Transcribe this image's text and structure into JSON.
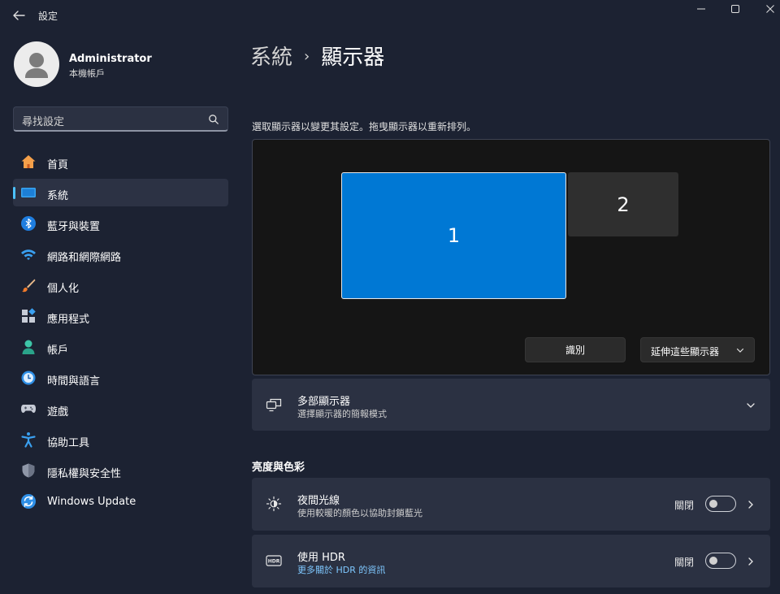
{
  "window": {
    "title": "設定"
  },
  "user": {
    "name": "Administrator",
    "account_type": "本機帳戶"
  },
  "search": {
    "placeholder": "尋找設定"
  },
  "nav": {
    "items": [
      {
        "label": "首頁",
        "icon": "home-icon",
        "active": false
      },
      {
        "label": "系統",
        "icon": "system-display-icon",
        "active": true
      },
      {
        "label": "藍牙與裝置",
        "icon": "bluetooth-icon",
        "active": false
      },
      {
        "label": "網路和網際網路",
        "icon": "wifi-icon",
        "active": false
      },
      {
        "label": "個人化",
        "icon": "brush-icon",
        "active": false
      },
      {
        "label": "應用程式",
        "icon": "apps-icon",
        "active": false
      },
      {
        "label": "帳戶",
        "icon": "account-icon",
        "active": false
      },
      {
        "label": "時間與語言",
        "icon": "time-language-icon",
        "active": false
      },
      {
        "label": "遊戲",
        "icon": "gamepad-icon",
        "active": false
      },
      {
        "label": "協助工具",
        "icon": "accessibility-icon",
        "active": false
      },
      {
        "label": "隱私權與安全性",
        "icon": "shield-icon",
        "active": false
      },
      {
        "label": "Windows Update",
        "icon": "windows-update-icon",
        "active": false
      }
    ]
  },
  "breadcrumb": {
    "parent": "系統",
    "separator": "›",
    "current": "顯示器"
  },
  "display_arrangement": {
    "instruction": "選取顯示器以變更其設定。拖曳顯示器以重新排列。",
    "monitors": [
      {
        "label": "1",
        "selected": true
      },
      {
        "label": "2",
        "selected": false
      }
    ],
    "identify_label": "識別",
    "extend_label": "延伸這些顯示器"
  },
  "multiple_displays": {
    "title": "多部顯示器",
    "subtitle": "選擇顯示器的簡報模式"
  },
  "brightness_section": {
    "heading": "亮度與色彩"
  },
  "night_light": {
    "title": "夜間光線",
    "subtitle": "使用較暖的顏色以協助封鎖藍光",
    "state_label": "關閉"
  },
  "hdr": {
    "title": "使用 HDR",
    "link": "更多關於 HDR 的資訊",
    "state_label": "關閉"
  },
  "colors": {
    "background": "#1c2232",
    "card": "#2b3142",
    "accent": "#0078d4",
    "accent_indicator": "#4cc2ff",
    "link": "#7fc8ff"
  }
}
